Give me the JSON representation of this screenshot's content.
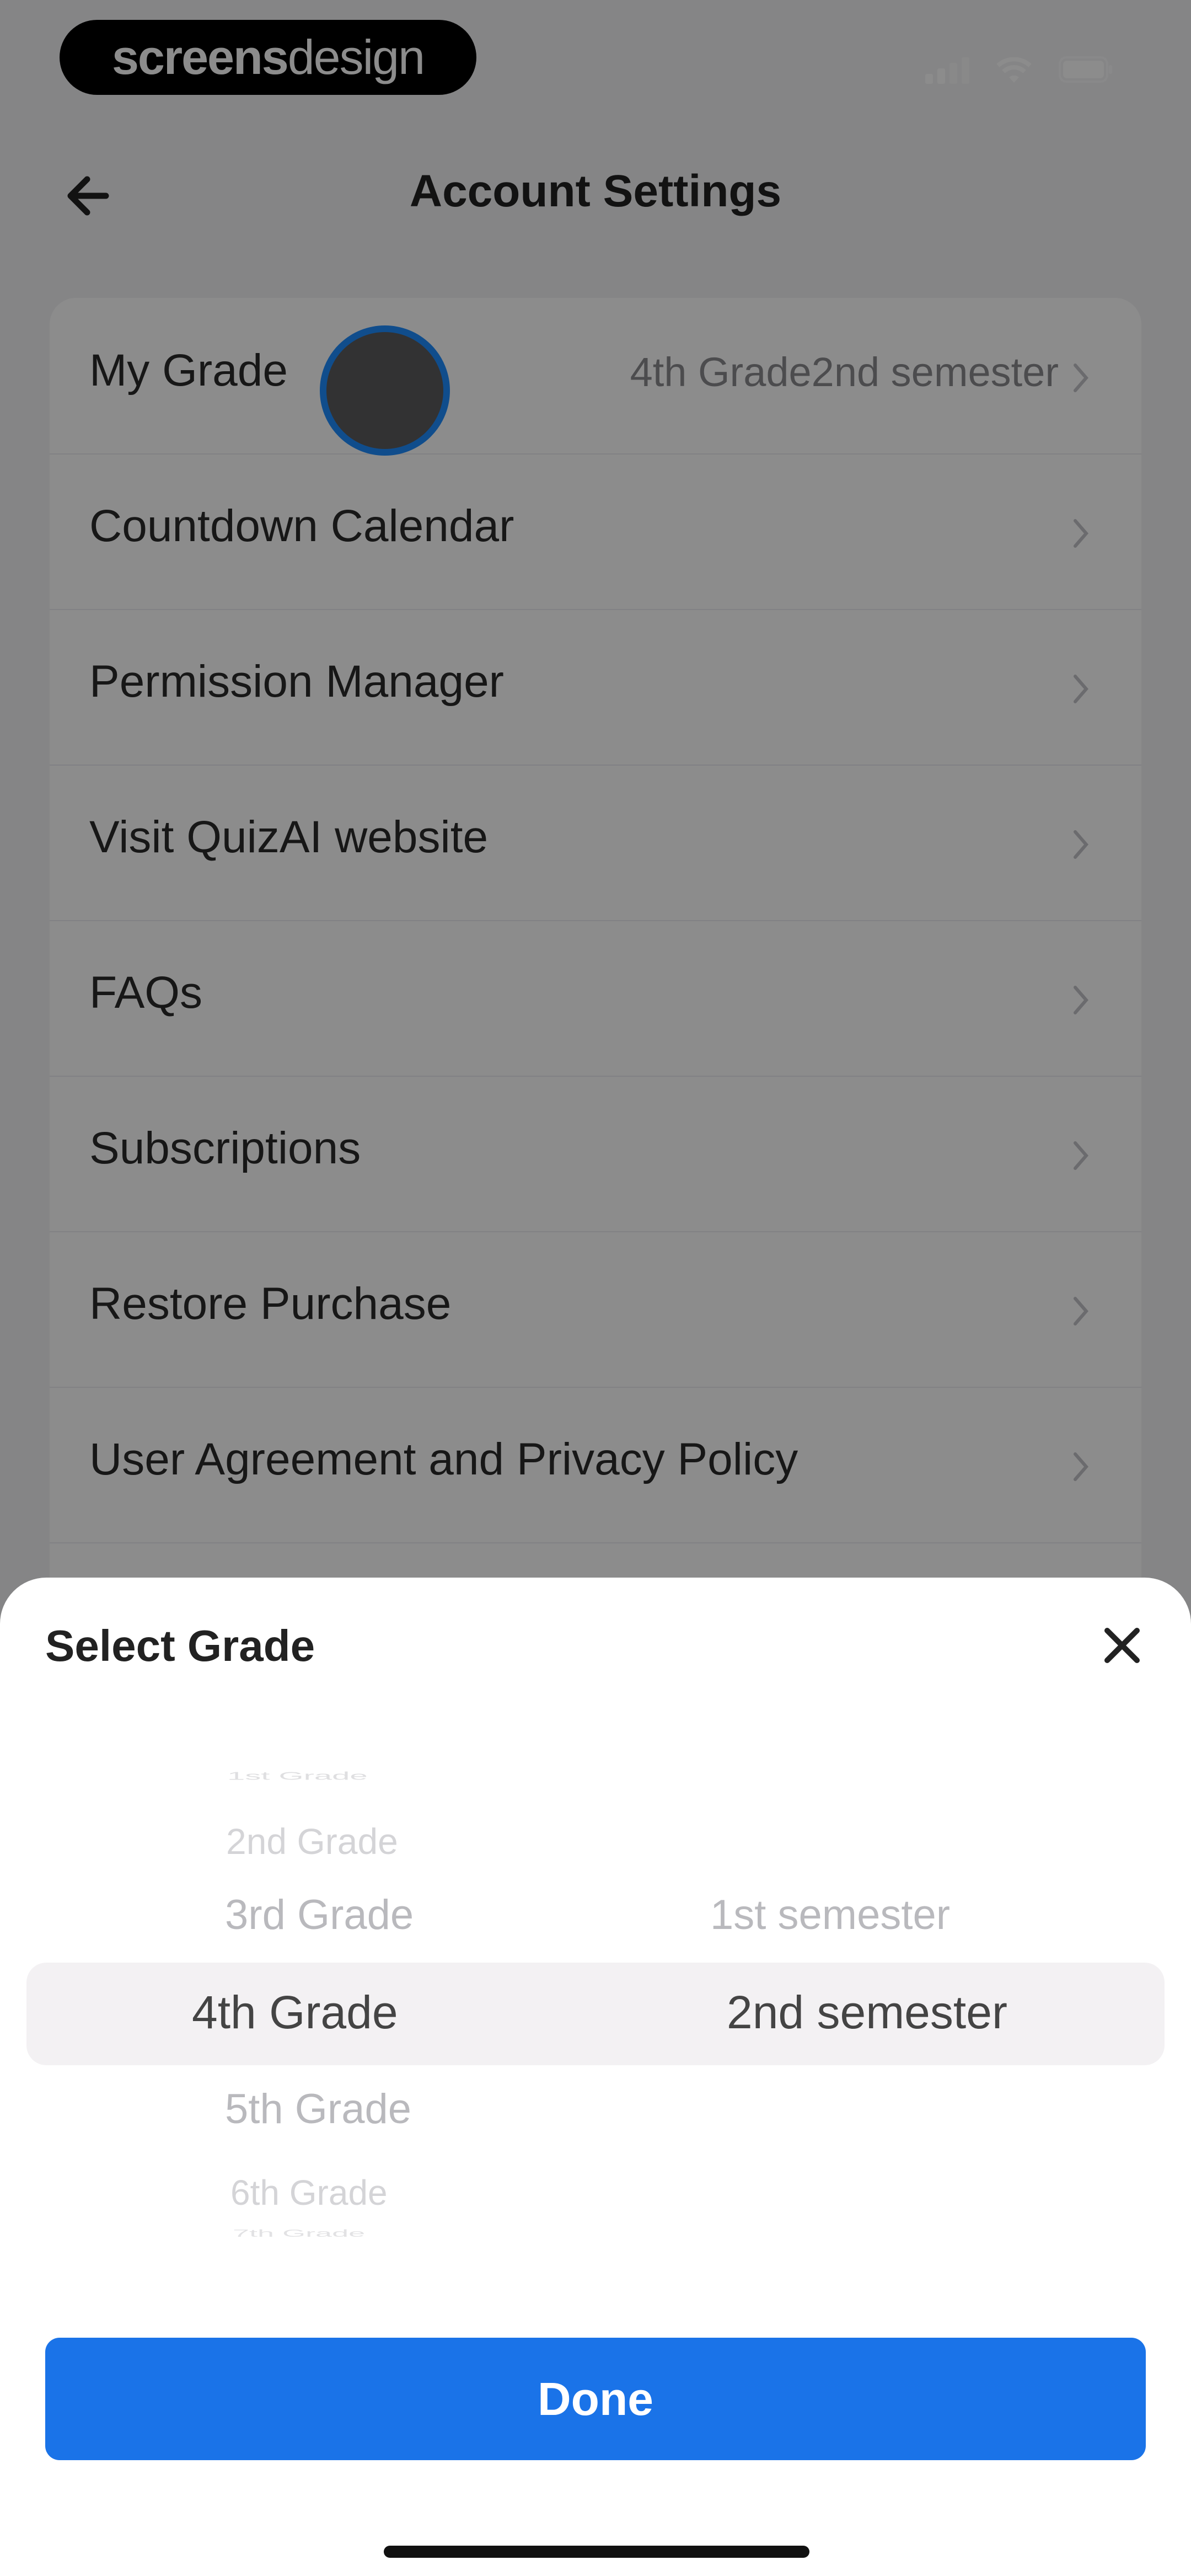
{
  "status_bar": {
    "brand_bold": "screens",
    "brand_light": "design"
  },
  "header": {
    "title": "Account Settings"
  },
  "settings": {
    "items": [
      {
        "label": "My Grade",
        "value": "4th Grade2nd semester"
      },
      {
        "label": "Countdown Calendar"
      },
      {
        "label": "Permission Manager"
      },
      {
        "label": "Visit QuizAI website"
      },
      {
        "label": "FAQs"
      },
      {
        "label": "Subscriptions"
      },
      {
        "label": "Restore Purchase"
      },
      {
        "label": "User Agreement and Privacy Policy"
      }
    ]
  },
  "grade_sheet": {
    "title": "Select Grade",
    "grades": [
      "1st Grade",
      "2nd Grade",
      "3rd Grade",
      "4th Grade",
      "5th Grade",
      "6th Grade",
      "7th Grade"
    ],
    "selected_grade": "4th Grade",
    "semesters": [
      "1st semester",
      "2nd semester"
    ],
    "selected_semester": "2nd semester",
    "done_label": "Done"
  },
  "colors": {
    "accent": "#1a73e8",
    "touch_ring": "#1e8cff"
  }
}
